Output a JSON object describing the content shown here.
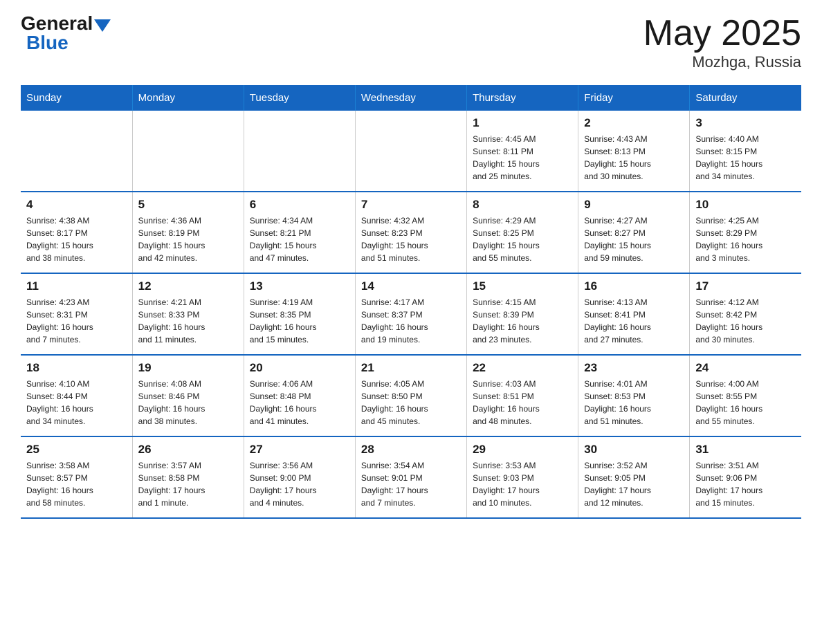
{
  "header": {
    "logo_general": "General",
    "logo_blue": "Blue",
    "month_year": "May 2025",
    "location": "Mozhga, Russia"
  },
  "weekdays": [
    "Sunday",
    "Monday",
    "Tuesday",
    "Wednesday",
    "Thursday",
    "Friday",
    "Saturday"
  ],
  "weeks": [
    [
      {
        "day": "",
        "info": ""
      },
      {
        "day": "",
        "info": ""
      },
      {
        "day": "",
        "info": ""
      },
      {
        "day": "",
        "info": ""
      },
      {
        "day": "1",
        "info": "Sunrise: 4:45 AM\nSunset: 8:11 PM\nDaylight: 15 hours\nand 25 minutes."
      },
      {
        "day": "2",
        "info": "Sunrise: 4:43 AM\nSunset: 8:13 PM\nDaylight: 15 hours\nand 30 minutes."
      },
      {
        "day": "3",
        "info": "Sunrise: 4:40 AM\nSunset: 8:15 PM\nDaylight: 15 hours\nand 34 minutes."
      }
    ],
    [
      {
        "day": "4",
        "info": "Sunrise: 4:38 AM\nSunset: 8:17 PM\nDaylight: 15 hours\nand 38 minutes."
      },
      {
        "day": "5",
        "info": "Sunrise: 4:36 AM\nSunset: 8:19 PM\nDaylight: 15 hours\nand 42 minutes."
      },
      {
        "day": "6",
        "info": "Sunrise: 4:34 AM\nSunset: 8:21 PM\nDaylight: 15 hours\nand 47 minutes."
      },
      {
        "day": "7",
        "info": "Sunrise: 4:32 AM\nSunset: 8:23 PM\nDaylight: 15 hours\nand 51 minutes."
      },
      {
        "day": "8",
        "info": "Sunrise: 4:29 AM\nSunset: 8:25 PM\nDaylight: 15 hours\nand 55 minutes."
      },
      {
        "day": "9",
        "info": "Sunrise: 4:27 AM\nSunset: 8:27 PM\nDaylight: 15 hours\nand 59 minutes."
      },
      {
        "day": "10",
        "info": "Sunrise: 4:25 AM\nSunset: 8:29 PM\nDaylight: 16 hours\nand 3 minutes."
      }
    ],
    [
      {
        "day": "11",
        "info": "Sunrise: 4:23 AM\nSunset: 8:31 PM\nDaylight: 16 hours\nand 7 minutes."
      },
      {
        "day": "12",
        "info": "Sunrise: 4:21 AM\nSunset: 8:33 PM\nDaylight: 16 hours\nand 11 minutes."
      },
      {
        "day": "13",
        "info": "Sunrise: 4:19 AM\nSunset: 8:35 PM\nDaylight: 16 hours\nand 15 minutes."
      },
      {
        "day": "14",
        "info": "Sunrise: 4:17 AM\nSunset: 8:37 PM\nDaylight: 16 hours\nand 19 minutes."
      },
      {
        "day": "15",
        "info": "Sunrise: 4:15 AM\nSunset: 8:39 PM\nDaylight: 16 hours\nand 23 minutes."
      },
      {
        "day": "16",
        "info": "Sunrise: 4:13 AM\nSunset: 8:41 PM\nDaylight: 16 hours\nand 27 minutes."
      },
      {
        "day": "17",
        "info": "Sunrise: 4:12 AM\nSunset: 8:42 PM\nDaylight: 16 hours\nand 30 minutes."
      }
    ],
    [
      {
        "day": "18",
        "info": "Sunrise: 4:10 AM\nSunset: 8:44 PM\nDaylight: 16 hours\nand 34 minutes."
      },
      {
        "day": "19",
        "info": "Sunrise: 4:08 AM\nSunset: 8:46 PM\nDaylight: 16 hours\nand 38 minutes."
      },
      {
        "day": "20",
        "info": "Sunrise: 4:06 AM\nSunset: 8:48 PM\nDaylight: 16 hours\nand 41 minutes."
      },
      {
        "day": "21",
        "info": "Sunrise: 4:05 AM\nSunset: 8:50 PM\nDaylight: 16 hours\nand 45 minutes."
      },
      {
        "day": "22",
        "info": "Sunrise: 4:03 AM\nSunset: 8:51 PM\nDaylight: 16 hours\nand 48 minutes."
      },
      {
        "day": "23",
        "info": "Sunrise: 4:01 AM\nSunset: 8:53 PM\nDaylight: 16 hours\nand 51 minutes."
      },
      {
        "day": "24",
        "info": "Sunrise: 4:00 AM\nSunset: 8:55 PM\nDaylight: 16 hours\nand 55 minutes."
      }
    ],
    [
      {
        "day": "25",
        "info": "Sunrise: 3:58 AM\nSunset: 8:57 PM\nDaylight: 16 hours\nand 58 minutes."
      },
      {
        "day": "26",
        "info": "Sunrise: 3:57 AM\nSunset: 8:58 PM\nDaylight: 17 hours\nand 1 minute."
      },
      {
        "day": "27",
        "info": "Sunrise: 3:56 AM\nSunset: 9:00 PM\nDaylight: 17 hours\nand 4 minutes."
      },
      {
        "day": "28",
        "info": "Sunrise: 3:54 AM\nSunset: 9:01 PM\nDaylight: 17 hours\nand 7 minutes."
      },
      {
        "day": "29",
        "info": "Sunrise: 3:53 AM\nSunset: 9:03 PM\nDaylight: 17 hours\nand 10 minutes."
      },
      {
        "day": "30",
        "info": "Sunrise: 3:52 AM\nSunset: 9:05 PM\nDaylight: 17 hours\nand 12 minutes."
      },
      {
        "day": "31",
        "info": "Sunrise: 3:51 AM\nSunset: 9:06 PM\nDaylight: 17 hours\nand 15 minutes."
      }
    ]
  ]
}
